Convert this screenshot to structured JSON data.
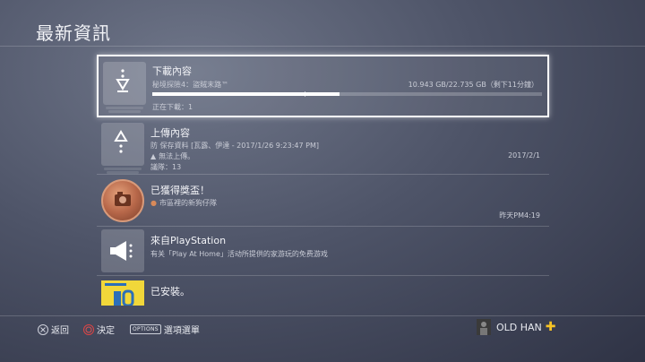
{
  "header": {
    "title": "最新資訊"
  },
  "items": [
    {
      "title": "下載內容",
      "subtitle": "秘境探險4：盜賊末路™",
      "size_text": "10.943 GB/22.735 GB（剩下11分鐘）",
      "progress": 0.48,
      "status": "正在下載：1",
      "icon": "download-icon"
    },
    {
      "title": "上傳內容",
      "subtitle": "防 保存資料 [瓦露、伊達 - 2017/1/26 9:23:47 PM]",
      "warning": "無法上傳。",
      "status": "議隊：13",
      "date": "2017/2/1",
      "icon": "upload-icon"
    },
    {
      "title": "已獲得獎盃！",
      "subtitle": "市區裡的新狗仔隊",
      "date": "昨天PM4:19",
      "icon": "trophy-icon"
    },
    {
      "title": "來自PlayStation",
      "subtitle": "有关「Play At Home」活动所提供的家游玩的免费游戏",
      "icon": "megaphone-icon"
    },
    {
      "title": "已安裝。",
      "icon": "game-thumbnail"
    }
  ],
  "footer": {
    "back_label": "返回",
    "confirm_label": "決定",
    "options_key": "OPTIONS",
    "options_label": "選項選單",
    "username": "OLD HAN"
  },
  "colors": {
    "accent_plus": "#f6c325",
    "background": "#4e5468"
  }
}
